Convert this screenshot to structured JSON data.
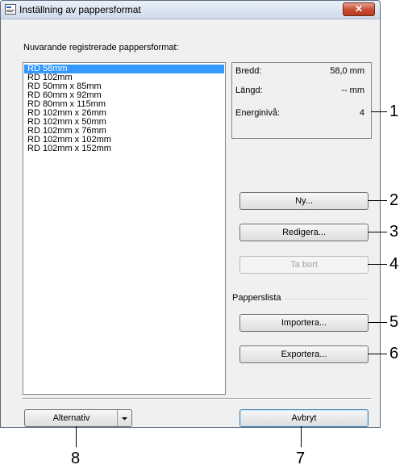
{
  "window": {
    "title": "Inställning av pappersformat",
    "close": "✕"
  },
  "list": {
    "label": "Nuvarande registrerade pappersformat:",
    "items": [
      "RD 58mm",
      "RD 102mm",
      "RD 50mm x 85mm",
      "RD 60mm x 92mm",
      "RD 80mm x 115mm",
      "RD 102mm x 26mm",
      "RD 102mm x 50mm",
      "RD 102mm x 76mm",
      "RD 102mm x 102mm",
      "RD 102mm x 152mm"
    ],
    "selected_index": 0
  },
  "info": {
    "width_label": "Bredd:",
    "width_value": "58,0 mm",
    "length_label": "Längd:",
    "length_value": "-- mm",
    "energy_label": "Energinivå:",
    "energy_value": "4"
  },
  "buttons": {
    "new": "Ny...",
    "edit": "Redigera...",
    "delete": "Ta bort",
    "import": "Importera...",
    "export": "Exportera...",
    "options": "Alternativ",
    "cancel": "Avbryt"
  },
  "paperlist_label": "Papperslista",
  "callouts": [
    "1",
    "2",
    "3",
    "4",
    "5",
    "6",
    "7",
    "8"
  ]
}
